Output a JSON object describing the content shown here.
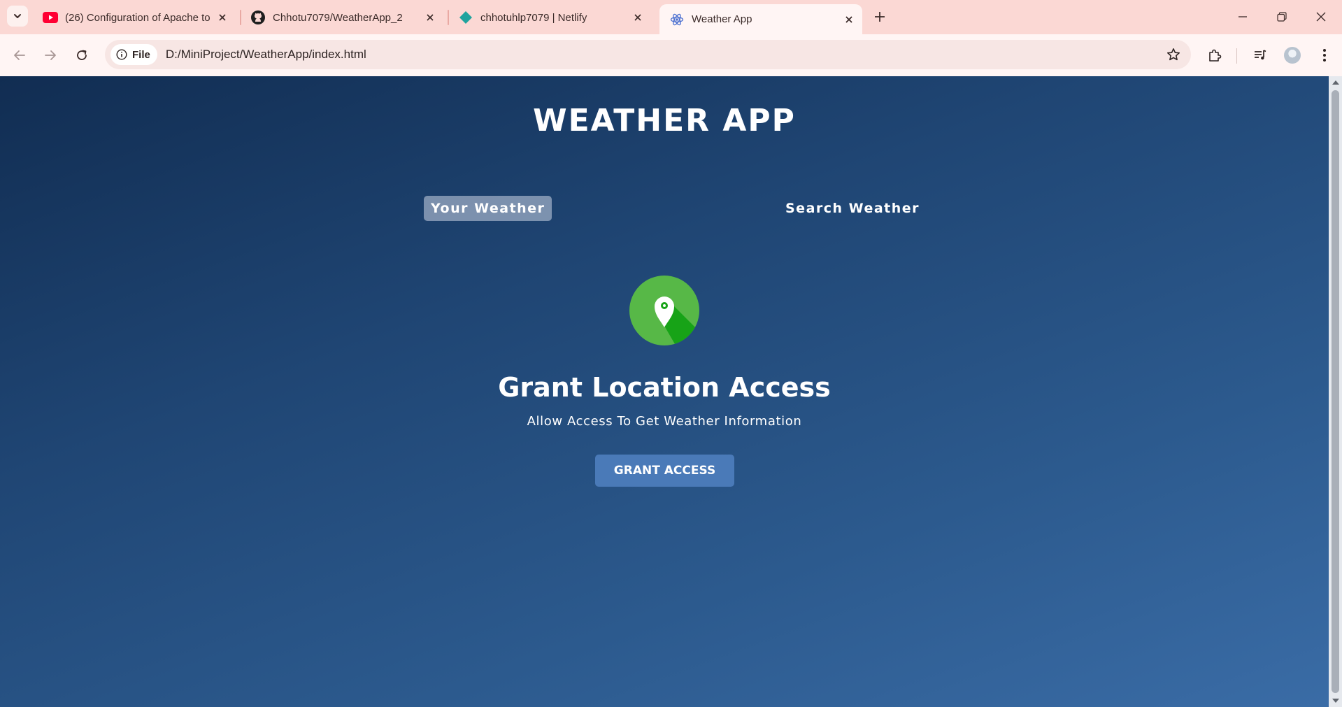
{
  "browser": {
    "tabs": [
      {
        "title": "(26) Configuration of Apache to",
        "favicon": "youtube-icon",
        "active": false
      },
      {
        "title": "Chhotu7079/WeatherApp_2",
        "favicon": "github-icon",
        "active": false
      },
      {
        "title": "chhotuhlp7079 | Netlify",
        "favicon": "netlify-icon",
        "active": false
      },
      {
        "title": "Weather App",
        "favicon": "react-icon",
        "active": true
      }
    ],
    "site_chip_label": "File",
    "url": "D:/MiniProject/WeatherApp/index.html"
  },
  "page": {
    "app_title": "WEATHER APP",
    "tabs": {
      "your_weather": "Your Weather",
      "search_weather": "Search Weather"
    },
    "grant": {
      "icon": "location-pin-icon",
      "title": "Grant Location Access",
      "subtitle": "Allow Access To Get Weather Information",
      "button_label": "GRANT ACCESS"
    }
  },
  "colors": {
    "tabstrip": "#fbd8d4",
    "toolbar": "#fff5f4",
    "bg_top": "#112d52",
    "bg_bottom": "#3a6ca6",
    "tab_active_bg": "rgba(219,226,239,0.5)",
    "button": "#4a7ab8",
    "pin_circle": "#57b847",
    "pin_shadow": "#17a317"
  }
}
